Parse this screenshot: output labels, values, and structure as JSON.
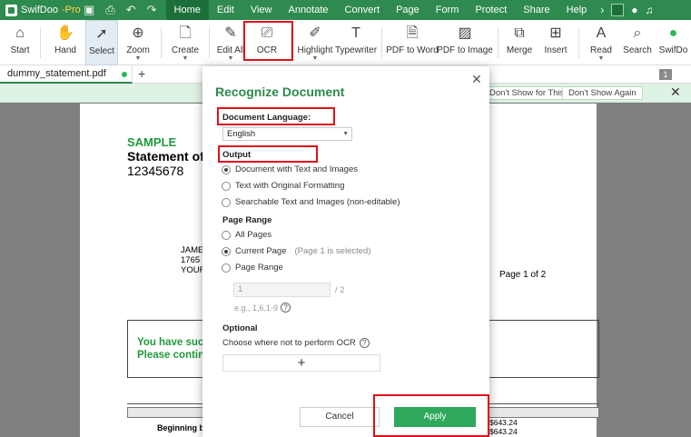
{
  "app": {
    "name": "SwifDoo",
    "edition": "-Pro"
  },
  "menu": [
    "Home",
    "Edit",
    "View",
    "Annotate",
    "Convert",
    "Page",
    "Form",
    "Protect",
    "Share",
    "Help"
  ],
  "ribbon": {
    "start": "Start",
    "hand": "Hand",
    "select": "Select",
    "zoom": "Zoom",
    "create": "Create",
    "edit_all": "Edit All",
    "ocr": "OCR",
    "highlight": "Highlight",
    "typewriter": "Typewriter",
    "pdf_to_word": "PDF to Word",
    "pdf_to_image": "PDF to Image",
    "merge": "Merge",
    "insert": "Insert",
    "read": "Read",
    "search": "Search",
    "swifdoc": "SwifDo"
  },
  "tabs": {
    "doc_name": "dummy_statement.pdf",
    "page_badge": "1"
  },
  "notification": {
    "dont_show_file": "Don't Show for This File",
    "dont_show_again": "Don't Show Again"
  },
  "document": {
    "sample": "SAMPLE",
    "statement": "Statement of",
    "account": "12345678",
    "addr1": "JAME",
    "addr2": "1765 S",
    "addr3": "YOUR",
    "page_of": "Page 1 of 2",
    "msg1": "You have succ",
    "msg2": "Please contin",
    "beginning": "Beginning ba",
    "amt1": "$643.24",
    "amt2": "$643.24"
  },
  "dialog": {
    "title": "Recognize Document",
    "doc_lang_label": "Document Language:",
    "language": "English",
    "output_label": "Output",
    "output_opts": [
      "Document with Text and Images",
      "Text with Original Formatting",
      "Searchable Text and Images (non-editable)"
    ],
    "page_range_label": "Page Range",
    "range_opts": [
      "All Pages",
      "Current Page",
      "Page Range"
    ],
    "current_hint": "(Page 1 is selected)",
    "range_value": "1",
    "range_total": "/ 2",
    "range_example": "e.g., 1,6,1-9",
    "optional_label": "Optional",
    "choose_label": "Choose where not to perform OCR",
    "add_symbol": "+",
    "cancel": "Cancel",
    "apply": "Apply"
  }
}
